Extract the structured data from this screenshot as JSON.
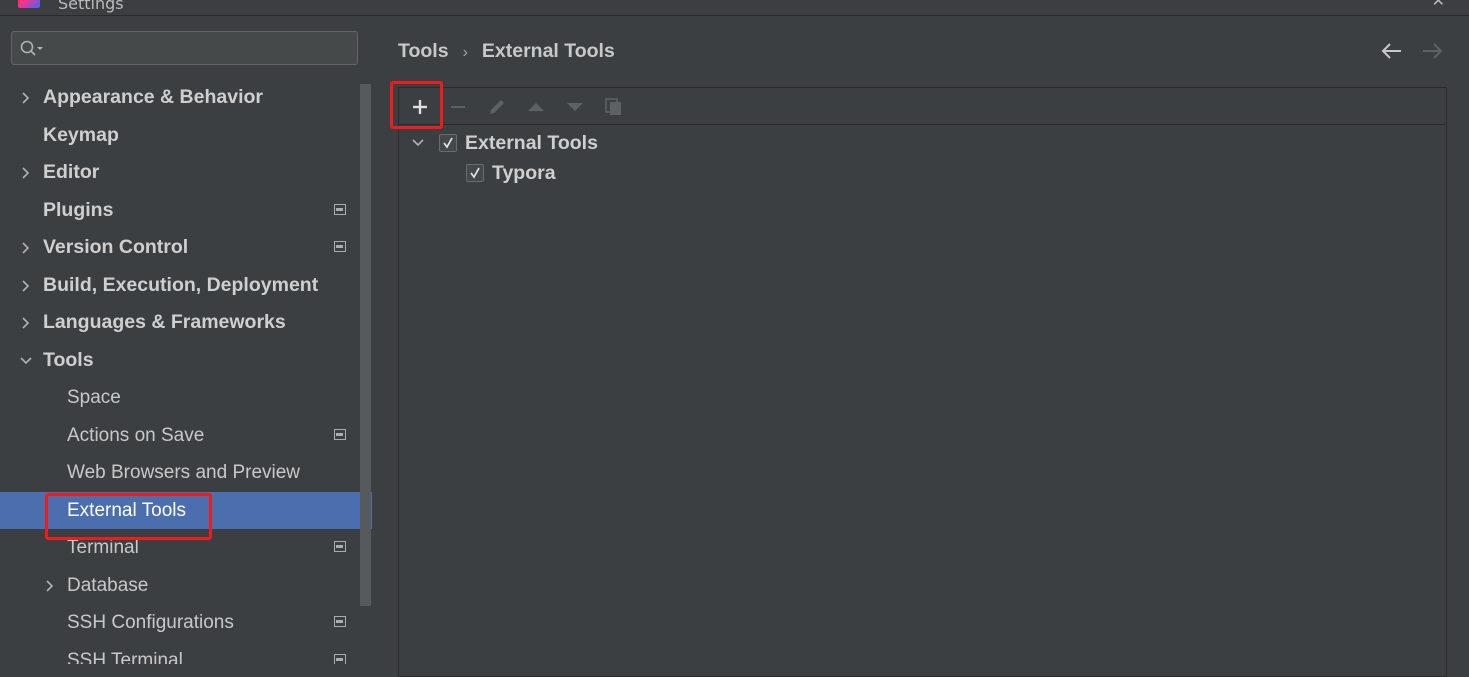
{
  "window": {
    "title": "Settings"
  },
  "search": {
    "placeholder": "",
    "value": ""
  },
  "sidebar": {
    "items": [
      {
        "label": "Appearance & Behavior",
        "level": 0,
        "expandable": true,
        "expanded": false,
        "project_icon": false
      },
      {
        "label": "Keymap",
        "level": 0,
        "expandable": false,
        "project_icon": false
      },
      {
        "label": "Editor",
        "level": 0,
        "expandable": true,
        "expanded": false,
        "project_icon": false
      },
      {
        "label": "Plugins",
        "level": 0,
        "expandable": false,
        "project_icon": true
      },
      {
        "label": "Version Control",
        "level": 0,
        "expandable": true,
        "expanded": false,
        "project_icon": true
      },
      {
        "label": "Build, Execution, Deployment",
        "level": 0,
        "expandable": true,
        "expanded": false,
        "project_icon": false
      },
      {
        "label": "Languages & Frameworks",
        "level": 0,
        "expandable": true,
        "expanded": false,
        "project_icon": false
      },
      {
        "label": "Tools",
        "level": 0,
        "expandable": true,
        "expanded": true,
        "project_icon": false
      },
      {
        "label": "Space",
        "level": 1,
        "expandable": false,
        "project_icon": false
      },
      {
        "label": "Actions on Save",
        "level": 1,
        "expandable": false,
        "project_icon": true
      },
      {
        "label": "Web Browsers and Preview",
        "level": 1,
        "expandable": false,
        "project_icon": false
      },
      {
        "label": "External Tools",
        "level": 1,
        "expandable": false,
        "project_icon": false,
        "selected": true
      },
      {
        "label": "Terminal",
        "level": 1,
        "expandable": false,
        "project_icon": true
      },
      {
        "label": "Database",
        "level": 1,
        "expandable": true,
        "expanded": false,
        "project_icon": false
      },
      {
        "label": "SSH Configurations",
        "level": 1,
        "expandable": false,
        "project_icon": true
      },
      {
        "label": "SSH Terminal",
        "level": 1,
        "expandable": false,
        "project_icon": true
      }
    ]
  },
  "breadcrumb": {
    "parent": "Tools",
    "separator": "›",
    "current": "External Tools"
  },
  "toolbar": {
    "buttons": [
      "add-icon",
      "remove-icon",
      "edit-icon",
      "move-up-icon",
      "move-down-icon",
      "copy-icon"
    ]
  },
  "tools_tree": {
    "group": {
      "label": "External Tools",
      "checked": true,
      "expanded": true
    },
    "items": [
      {
        "label": "Typora",
        "checked": true
      }
    ]
  },
  "colors": {
    "background": "#3c3f41",
    "selection": "#4b6eaf",
    "highlight_box": "#ee1c1c",
    "text": "#c8c8c8"
  }
}
